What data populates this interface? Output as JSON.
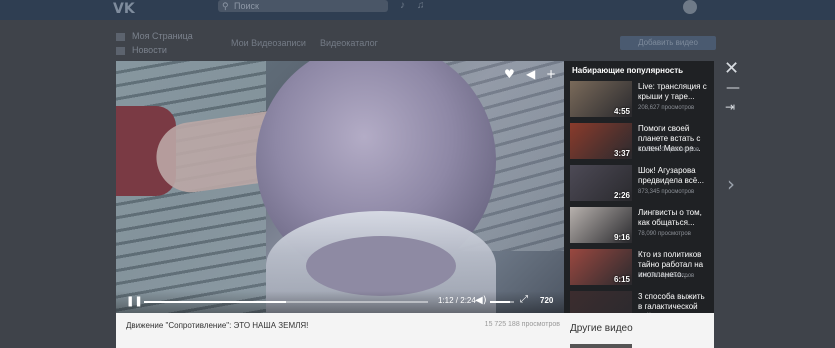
{
  "vk": {
    "logo": "VK",
    "search_placeholder": "Поиск",
    "nav": [
      "Моя Страница",
      "Новости"
    ],
    "tabs": [
      "Мои Видеозаписи",
      "Видеокаталог"
    ],
    "add_video": "Добавить видео"
  },
  "player": {
    "current_time": "1:12",
    "duration": "2:24",
    "time_text": "1:12 / 2:24",
    "progress": 0.5,
    "volume": 0.85,
    "quality": "720",
    "title": "Движение \"Сопротивление\": ЭТО НАША ЗЕМЛЯ!",
    "views": "15 725 188 просмотров",
    "icons": [
      "heart-icon",
      "share-icon",
      "plus-icon",
      "play-icon",
      "volume-icon",
      "fullscreen-icon"
    ]
  },
  "trending": {
    "title": "Набирающие популярность",
    "items": [
      {
        "title": "Live: трансляция с крыши у таре...",
        "views": "208,627 просмотров",
        "duration": "4:55",
        "color": "#7a6a5a"
      },
      {
        "title": "Помоги своей планете встать с колен! Макс ре...",
        "views": "1,185,520 просмотров",
        "duration": "3:37",
        "color": "#8a3b2c"
      },
      {
        "title": "Шок! Агузарова предвидела всё...",
        "views": "873,345 просмотров",
        "duration": "2:26",
        "color": "#4d4a56"
      },
      {
        "title": "Лингвисты о том, как общаться...",
        "views": "78,090 просмотров",
        "duration": "9:16",
        "color": "#b7b1ad"
      },
      {
        "title": "Кто из политиков тайно работал на иноплането...",
        "views": "600,000 просмотров",
        "duration": "6:15",
        "color": "#9a4840"
      },
      {
        "title": "3 способа выжить в галактической войне",
        "views": "",
        "duration": "",
        "color": "#3c2c2e"
      }
    ]
  },
  "other_videos": "Другие видео",
  "overlay": {
    "close": "✕",
    "minimize": "—",
    "pin": "⇥",
    "next": "›"
  }
}
